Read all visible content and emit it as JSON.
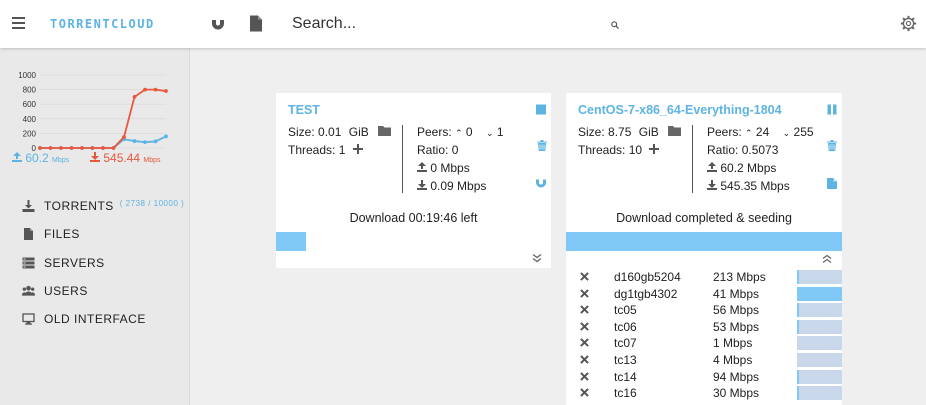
{
  "app": {
    "logo": "TORRENTCLOUD",
    "search_placeholder": "Search..."
  },
  "sidebar": {
    "chart_data": {
      "type": "line",
      "y_ticks": [
        "1000",
        "800",
        "600",
        "400",
        "200",
        "0"
      ],
      "ylim": [
        0,
        1000
      ],
      "series": [
        {
          "values": [
            0,
            0,
            0,
            0,
            0,
            0,
            0,
            0,
            120,
            95,
            80,
            90,
            160
          ],
          "color": "#5db4e3"
        },
        {
          "values": [
            0,
            0,
            0,
            0,
            0,
            0,
            0,
            0,
            150,
            700,
            800,
            800,
            780
          ],
          "color": "#e9573f"
        }
      ]
    },
    "upload_speed": "60.2",
    "download_speed": "545.44",
    "speed_unit": "Mbps",
    "nav": [
      {
        "label": "TORRENTS",
        "count": "( 2738 / 10000 )"
      },
      {
        "label": "FILES"
      },
      {
        "label": "SERVERS"
      },
      {
        "label": "USERS"
      },
      {
        "label": "OLD INTERFACE"
      }
    ]
  },
  "torrents": [
    {
      "title": "TEST",
      "size_label": "Size:",
      "size": "0.01",
      "size_unit": "GiB",
      "threads_label": "Threads:",
      "threads": "1",
      "peers_label": "Peers:",
      "peers_up": "0",
      "peers_down": "1",
      "ratio_label": "Ratio:",
      "ratio": "0",
      "up_speed": "0 Mbps",
      "down_speed": "0.09 Mbps",
      "status": "Download 00:19:46 left",
      "progress": 0.11
    },
    {
      "title": "CentOS-7-x86_64-Everything-1804",
      "size_label": "Size:",
      "size": "8.75",
      "size_unit": "GiB",
      "threads_label": "Threads:",
      "threads": "10",
      "peers_label": "Peers:",
      "peers_up": "24",
      "peers_down": "255",
      "ratio_label": "Ratio:",
      "ratio": "0.5073",
      "up_speed": "60.2 Mbps",
      "down_speed": "545.35 Mbps",
      "status": "Download completed & seeding",
      "progress": 1.0,
      "peer_list": [
        {
          "name": "d160gb5204",
          "speed": "213 Mbps",
          "level": 0.04
        },
        {
          "name": "dg1tgb4302",
          "speed": "41 Mbps",
          "level": 1.0
        },
        {
          "name": "tc05",
          "speed": "56 Mbps",
          "level": 0.04
        },
        {
          "name": "tc06",
          "speed": "53 Mbps",
          "level": 0.04
        },
        {
          "name": "tc07",
          "speed": "1 Mbps",
          "level": 0.0
        },
        {
          "name": "tc13",
          "speed": "4 Mbps",
          "level": 0.0
        },
        {
          "name": "tc14",
          "speed": "94 Mbps",
          "level": 0.04
        },
        {
          "name": "tc16",
          "speed": "30 Mbps",
          "level": 0.04
        }
      ]
    }
  ]
}
